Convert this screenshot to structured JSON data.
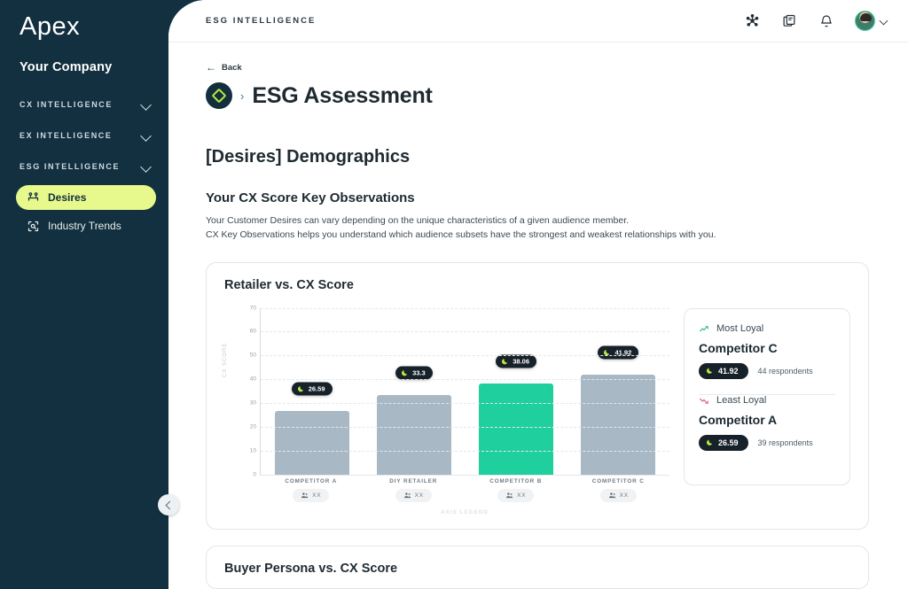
{
  "sidebar": {
    "brand": "Apex",
    "company": "Your Company",
    "groups": [
      {
        "label": "CX INTELLIGENCE",
        "icon": "chevron-down-icon"
      },
      {
        "label": "EX INTELLIGENCE",
        "icon": "chevron-down-icon"
      },
      {
        "label": "ESG INTELLIGENCE",
        "icon": "chevron-down-icon"
      }
    ],
    "items": [
      {
        "label": "Desires",
        "icon": "people-group-icon",
        "active": true
      },
      {
        "label": "Industry Trends",
        "icon": "scan-search-icon",
        "active": false
      }
    ],
    "collapse_icon": "chevron-left-icon"
  },
  "topbar": {
    "title": "ESG INTELLIGENCE",
    "actions": [
      {
        "name": "network-nodes-icon"
      },
      {
        "name": "documents-copy-icon"
      },
      {
        "name": "bell-icon"
      }
    ],
    "avatar_icon": "avatar",
    "avatar_chevron": "chevron-down-icon"
  },
  "page": {
    "back_label": "Back",
    "back_icon": "arrow-left-icon",
    "breadcrumb_separator": "›",
    "logo_icon": "diamond-logo-icon",
    "title": "ESG Assessment",
    "section_title": "[Desires] Demographics",
    "sub_title": "Your CX Score Key Observations",
    "body_line_1": "Your Customer Desires can vary depending on the unique characteristics of a given audience member.",
    "body_line_2": "CX  Key Observations helps you understand which audience subsets have the strongest and weakest relationships with you."
  },
  "chart_card": {
    "title": "Retailer vs. CX Score",
    "axis_legend": "AXIS LEGEND"
  },
  "chart_data": {
    "type": "bar",
    "title": "Retailer vs. CX Score",
    "xlabel": "",
    "ylabel": "CX SCORE",
    "ylim": [
      0,
      70
    ],
    "yticks": [
      0,
      10,
      20,
      30,
      40,
      50,
      60,
      70
    ],
    "grid": true,
    "legend": "none",
    "categories": [
      "COMPETITOR A",
      "DIY RETAILER",
      "COMPETITOR B",
      "COMPETITOR C"
    ],
    "values": [
      26.59,
      33.3,
      38.06,
      41.92
    ],
    "value_labels": [
      "26.59",
      "33.3",
      "38.06",
      "41.92"
    ],
    "respondent_labels": [
      "XX",
      "XX",
      "XX",
      "XX"
    ],
    "bar_colors": [
      "#a8b8c4",
      "#a8b8c4",
      "#20cf9e",
      "#a8b8c4"
    ],
    "highlight_index": 2
  },
  "insights": {
    "most": {
      "kicker": "Most Loyal",
      "kicker_icon": "trend-up-icon",
      "name": "Competitor C",
      "value": "41.92",
      "respondents": "44 respondents",
      "moon_icon": "moon-icon"
    },
    "least": {
      "kicker": "Least Loyal",
      "kicker_icon": "trend-down-icon",
      "name": "Competitor A",
      "value": "26.59",
      "respondents": "39 respondents",
      "moon_icon": "moon-icon"
    }
  },
  "second_card": {
    "title": "Buyer Persona vs. CX Score"
  },
  "colors": {
    "sidebar_bg": "#12303f",
    "accent_lime": "#e7f88c",
    "accent_teal": "#20cf9e",
    "bar_grey": "#a8b8c4",
    "pill_dark": "#17212a",
    "trend_up": "#3fb98a",
    "trend_down": "#e0607f"
  }
}
